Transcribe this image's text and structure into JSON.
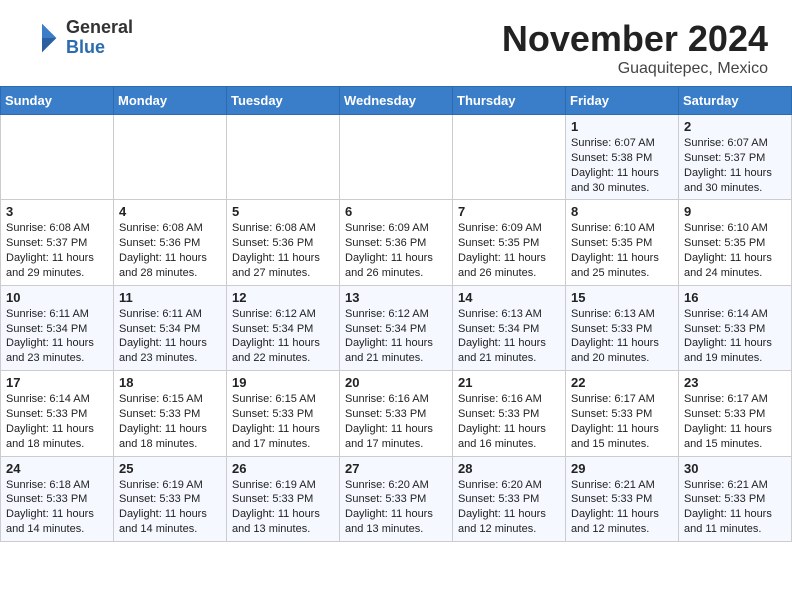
{
  "header": {
    "logo_general": "General",
    "logo_blue": "Blue",
    "month_title": "November 2024",
    "location": "Guaquitepec, Mexico"
  },
  "weekdays": [
    "Sunday",
    "Monday",
    "Tuesday",
    "Wednesday",
    "Thursday",
    "Friday",
    "Saturday"
  ],
  "weeks": [
    [
      {
        "day": "",
        "content": ""
      },
      {
        "day": "",
        "content": ""
      },
      {
        "day": "",
        "content": ""
      },
      {
        "day": "",
        "content": ""
      },
      {
        "day": "",
        "content": ""
      },
      {
        "day": "1",
        "content": "Sunrise: 6:07 AM\nSunset: 5:38 PM\nDaylight: 11 hours and 30 minutes."
      },
      {
        "day": "2",
        "content": "Sunrise: 6:07 AM\nSunset: 5:37 PM\nDaylight: 11 hours and 30 minutes."
      }
    ],
    [
      {
        "day": "3",
        "content": "Sunrise: 6:08 AM\nSunset: 5:37 PM\nDaylight: 11 hours and 29 minutes."
      },
      {
        "day": "4",
        "content": "Sunrise: 6:08 AM\nSunset: 5:36 PM\nDaylight: 11 hours and 28 minutes."
      },
      {
        "day": "5",
        "content": "Sunrise: 6:08 AM\nSunset: 5:36 PM\nDaylight: 11 hours and 27 minutes."
      },
      {
        "day": "6",
        "content": "Sunrise: 6:09 AM\nSunset: 5:36 PM\nDaylight: 11 hours and 26 minutes."
      },
      {
        "day": "7",
        "content": "Sunrise: 6:09 AM\nSunset: 5:35 PM\nDaylight: 11 hours and 26 minutes."
      },
      {
        "day": "8",
        "content": "Sunrise: 6:10 AM\nSunset: 5:35 PM\nDaylight: 11 hours and 25 minutes."
      },
      {
        "day": "9",
        "content": "Sunrise: 6:10 AM\nSunset: 5:35 PM\nDaylight: 11 hours and 24 minutes."
      }
    ],
    [
      {
        "day": "10",
        "content": "Sunrise: 6:11 AM\nSunset: 5:34 PM\nDaylight: 11 hours and 23 minutes."
      },
      {
        "day": "11",
        "content": "Sunrise: 6:11 AM\nSunset: 5:34 PM\nDaylight: 11 hours and 23 minutes."
      },
      {
        "day": "12",
        "content": "Sunrise: 6:12 AM\nSunset: 5:34 PM\nDaylight: 11 hours and 22 minutes."
      },
      {
        "day": "13",
        "content": "Sunrise: 6:12 AM\nSunset: 5:34 PM\nDaylight: 11 hours and 21 minutes."
      },
      {
        "day": "14",
        "content": "Sunrise: 6:13 AM\nSunset: 5:34 PM\nDaylight: 11 hours and 21 minutes."
      },
      {
        "day": "15",
        "content": "Sunrise: 6:13 AM\nSunset: 5:33 PM\nDaylight: 11 hours and 20 minutes."
      },
      {
        "day": "16",
        "content": "Sunrise: 6:14 AM\nSunset: 5:33 PM\nDaylight: 11 hours and 19 minutes."
      }
    ],
    [
      {
        "day": "17",
        "content": "Sunrise: 6:14 AM\nSunset: 5:33 PM\nDaylight: 11 hours and 18 minutes."
      },
      {
        "day": "18",
        "content": "Sunrise: 6:15 AM\nSunset: 5:33 PM\nDaylight: 11 hours and 18 minutes."
      },
      {
        "day": "19",
        "content": "Sunrise: 6:15 AM\nSunset: 5:33 PM\nDaylight: 11 hours and 17 minutes."
      },
      {
        "day": "20",
        "content": "Sunrise: 6:16 AM\nSunset: 5:33 PM\nDaylight: 11 hours and 17 minutes."
      },
      {
        "day": "21",
        "content": "Sunrise: 6:16 AM\nSunset: 5:33 PM\nDaylight: 11 hours and 16 minutes."
      },
      {
        "day": "22",
        "content": "Sunrise: 6:17 AM\nSunset: 5:33 PM\nDaylight: 11 hours and 15 minutes."
      },
      {
        "day": "23",
        "content": "Sunrise: 6:17 AM\nSunset: 5:33 PM\nDaylight: 11 hours and 15 minutes."
      }
    ],
    [
      {
        "day": "24",
        "content": "Sunrise: 6:18 AM\nSunset: 5:33 PM\nDaylight: 11 hours and 14 minutes."
      },
      {
        "day": "25",
        "content": "Sunrise: 6:19 AM\nSunset: 5:33 PM\nDaylight: 11 hours and 14 minutes."
      },
      {
        "day": "26",
        "content": "Sunrise: 6:19 AM\nSunset: 5:33 PM\nDaylight: 11 hours and 13 minutes."
      },
      {
        "day": "27",
        "content": "Sunrise: 6:20 AM\nSunset: 5:33 PM\nDaylight: 11 hours and 13 minutes."
      },
      {
        "day": "28",
        "content": "Sunrise: 6:20 AM\nSunset: 5:33 PM\nDaylight: 11 hours and 12 minutes."
      },
      {
        "day": "29",
        "content": "Sunrise: 6:21 AM\nSunset: 5:33 PM\nDaylight: 11 hours and 12 minutes."
      },
      {
        "day": "30",
        "content": "Sunrise: 6:21 AM\nSunset: 5:33 PM\nDaylight: 11 hours and 11 minutes."
      }
    ]
  ]
}
